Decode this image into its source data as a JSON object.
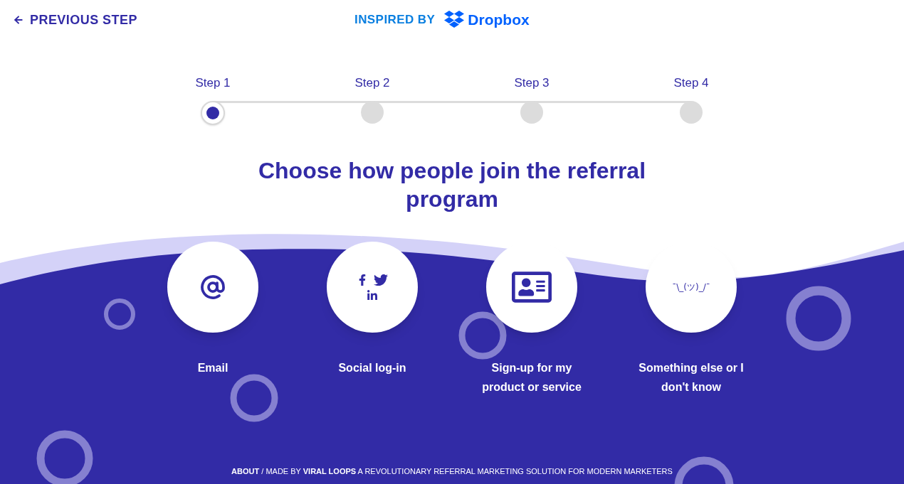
{
  "header": {
    "back_link": "PREVIOUS STEP",
    "inspired_label": "INSPIRED BY",
    "brand": "Dropbox"
  },
  "steps": [
    {
      "label": "Step 1",
      "selected": true
    },
    {
      "label": "Step 2",
      "selected": false
    },
    {
      "label": "Step 3",
      "selected": false
    },
    {
      "label": "Step 4",
      "selected": false
    }
  ],
  "title": "Choose how people join the referral program",
  "options": [
    {
      "kind": "email",
      "label": "Email"
    },
    {
      "kind": "social",
      "label": "Social log-in"
    },
    {
      "kind": "signup",
      "label": "Sign-up for my product or service"
    },
    {
      "kind": "text",
      "symbol": "¯\\_(ツ)_/¯",
      "label": "Something else or I don't know"
    }
  ],
  "footer": {
    "about": "ABOUT",
    "made_by": "/ MADE BY",
    "brand": "VIRAL LOOPS",
    "tagline": "A REVOLUTIONARY REFERRAL MARKETING SOLUTION FOR MODERN MARKETERS"
  }
}
